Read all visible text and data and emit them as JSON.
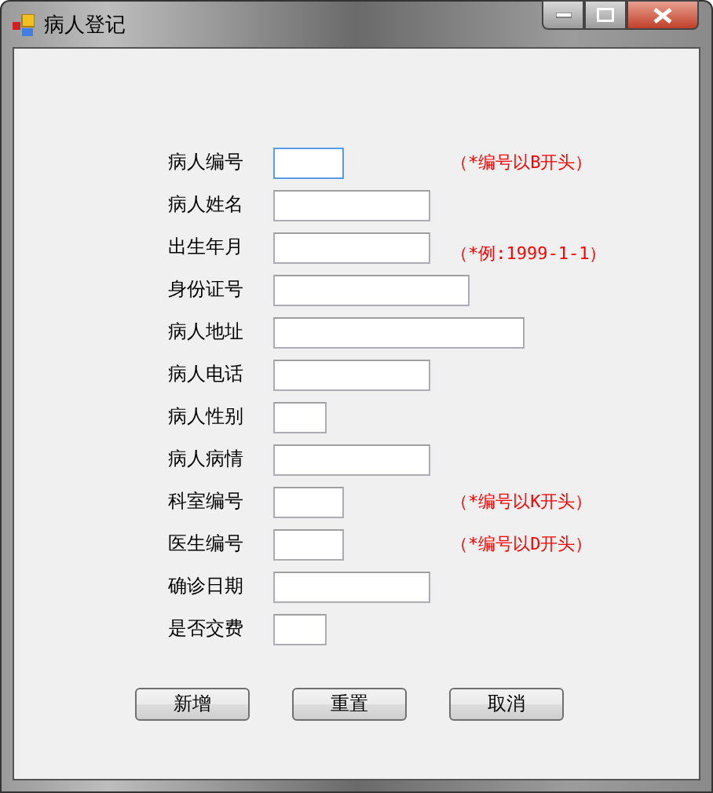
{
  "window": {
    "title": "病人登记"
  },
  "fields": [
    {
      "label": "病人编号",
      "focused": true,
      "hint": "（*编号以B开头）"
    },
    {
      "label": "病人姓名",
      "focused": false
    },
    {
      "label": "出生年月",
      "focused": false,
      "hint": "（*例:1999-1-1）"
    },
    {
      "label": "身份证号",
      "focused": false
    },
    {
      "label": "病人地址",
      "focused": false
    },
    {
      "label": "病人电话",
      "focused": false
    },
    {
      "label": "病人性别",
      "focused": false
    },
    {
      "label": "病人病情",
      "focused": false
    },
    {
      "label": "科室编号",
      "focused": false,
      "hint": "（*编号以K开头）"
    },
    {
      "label": "医生编号",
      "focused": false,
      "hint": "（*编号以D开头）"
    },
    {
      "label": "确诊日期",
      "focused": false
    },
    {
      "label": "是否交费",
      "focused": false
    }
  ],
  "buttons": [
    "新增",
    "重置",
    "取消"
  ]
}
